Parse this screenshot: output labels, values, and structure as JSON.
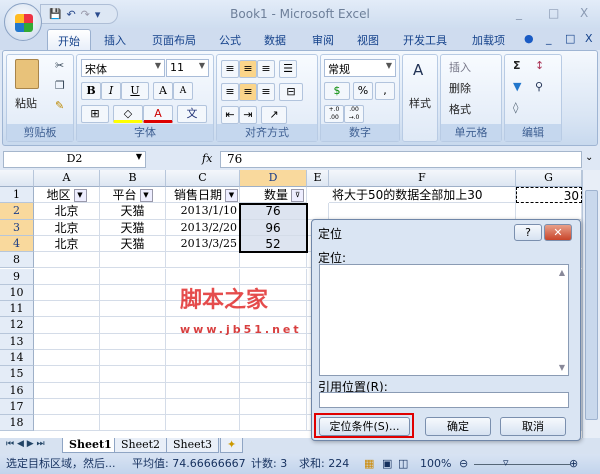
{
  "window": {
    "title": "Book1 - Microsoft Excel",
    "minimize": "_",
    "maximize": "□",
    "close": "X"
  },
  "qat": {
    "save": "💾",
    "undo": "↶",
    "redo": "↷",
    "more": "▾"
  },
  "tabs": [
    "开始",
    "插入",
    "页面布局",
    "公式",
    "数据",
    "审阅",
    "视图",
    "开发工具",
    "加载项"
  ],
  "ribbon": {
    "clipboard": {
      "label": "剪贴板",
      "paste": "粘贴"
    },
    "font": {
      "label": "字体",
      "font_name": "宋体",
      "font_size": "11",
      "bold": "B",
      "italic": "I",
      "underline": "U",
      "grow": "A",
      "shrink": "A",
      "phonetic": "文"
    },
    "alignment": {
      "label": "对齐方式"
    },
    "number": {
      "label": "数字",
      "format": "常规",
      "percent": "%",
      "comma": ",",
      "inc_decimal": "+.0 .00",
      "dec_decimal": ".00 →.0"
    },
    "styles": {
      "label": "样式"
    },
    "cells": {
      "label": "单元格",
      "insert": "插入",
      "delete": "删除",
      "format": "格式"
    },
    "editing": {
      "label": "编辑",
      "sum": "Σ"
    }
  },
  "formula_bar": {
    "name_box": "D2",
    "fx": "fx",
    "value": "76"
  },
  "columns": [
    "A",
    "B",
    "C",
    "D",
    "E",
    "F",
    "G"
  ],
  "rows": [
    "1",
    "2",
    "3",
    "4",
    "8",
    "9",
    "10",
    "11",
    "12",
    "13",
    "14",
    "15",
    "16",
    "17",
    "18"
  ],
  "cells": {
    "header": [
      "地区",
      "平台",
      "销售日期",
      "数量"
    ],
    "data": [
      [
        "北京",
        "天猫",
        "2013/1/10",
        "76"
      ],
      [
        "北京",
        "天猫",
        "2013/2/20",
        "96"
      ],
      [
        "北京",
        "天猫",
        "2013/3/25",
        "52"
      ]
    ],
    "F1": "将大于50的数据全部加上30",
    "G1": "30"
  },
  "sheets": [
    "Sheet1",
    "Sheet2",
    "Sheet3"
  ],
  "status": {
    "message": "选定目标区域，然后...",
    "average": "平均值: 74.66666667",
    "count": "计数: 3",
    "sum": "求和: 224",
    "zoom": "100%"
  },
  "dialog": {
    "title": "定位",
    "list_label": "定位:",
    "ref_label": "引用位置(R):",
    "special_button": "定位条件(S)...",
    "ok": "确定",
    "cancel": "取消",
    "help": "?",
    "close": "✕"
  },
  "watermark": {
    "text": "脚本之家",
    "url": "www.jb51.net"
  },
  "colors": {
    "accent": "#15428b",
    "selection": "#f9d99d",
    "highlight_box": "#e00000"
  }
}
